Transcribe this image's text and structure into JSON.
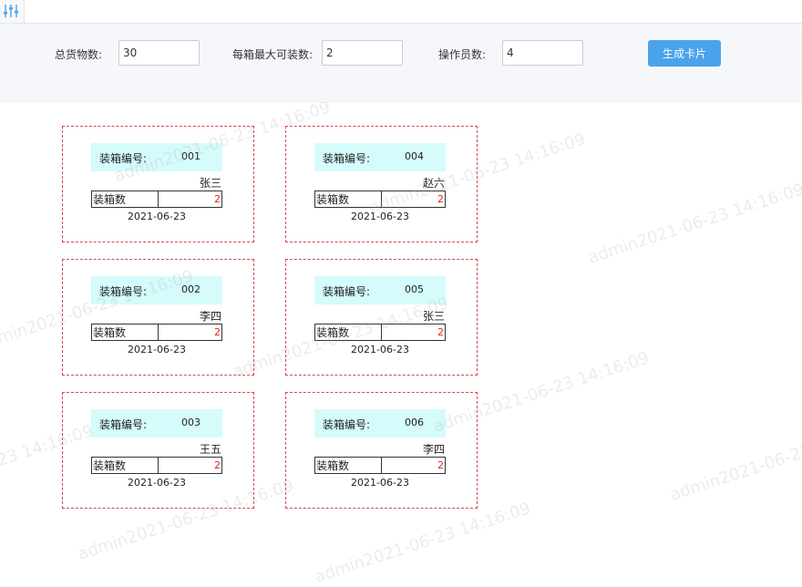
{
  "form": {
    "total_label": "总货物数:",
    "total_value": "30",
    "max_label": "每箱最大可装数:",
    "max_value": "2",
    "operators_label": "操作员数:",
    "operators_value": "4",
    "generate_label": "生成卡片"
  },
  "card_labels": {
    "box_no_label": "装箱编号:",
    "count_label": "装箱数"
  },
  "cards": [
    {
      "box_no": "001",
      "operator": "张三",
      "count": "2",
      "date": "2021-06-23"
    },
    {
      "box_no": "004",
      "operator": "赵六",
      "count": "2",
      "date": "2021-06-23"
    },
    {
      "box_no": "002",
      "operator": "李四",
      "count": "2",
      "date": "2021-06-23"
    },
    {
      "box_no": "005",
      "operator": "张三",
      "count": "2",
      "date": "2021-06-23"
    },
    {
      "box_no": "003",
      "operator": "王五",
      "count": "2",
      "date": "2021-06-23"
    },
    {
      "box_no": "006",
      "operator": "李四",
      "count": "2",
      "date": "2021-06-23"
    }
  ],
  "watermark": "admin2021-06-23 14:16:09"
}
